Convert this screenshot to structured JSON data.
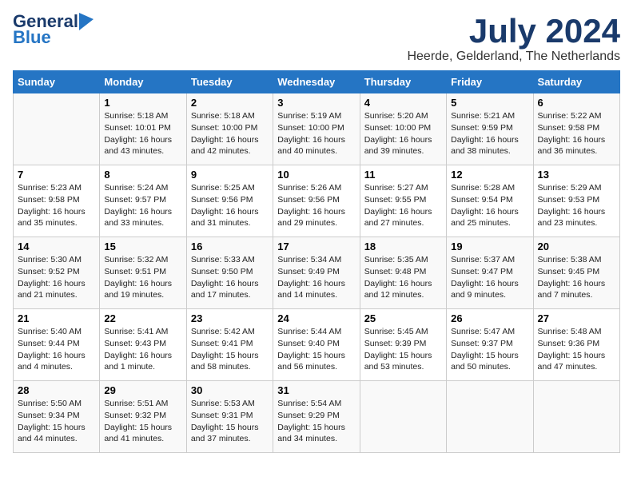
{
  "logo": {
    "general": "General",
    "blue": "Blue"
  },
  "title": "July 2024",
  "location": "Heerde, Gelderland, The Netherlands",
  "weekdays": [
    "Sunday",
    "Monday",
    "Tuesday",
    "Wednesday",
    "Thursday",
    "Friday",
    "Saturday"
  ],
  "weeks": [
    [
      {
        "day": "",
        "info": ""
      },
      {
        "day": "1",
        "info": "Sunrise: 5:18 AM\nSunset: 10:01 PM\nDaylight: 16 hours\nand 43 minutes."
      },
      {
        "day": "2",
        "info": "Sunrise: 5:18 AM\nSunset: 10:00 PM\nDaylight: 16 hours\nand 42 minutes."
      },
      {
        "day": "3",
        "info": "Sunrise: 5:19 AM\nSunset: 10:00 PM\nDaylight: 16 hours\nand 40 minutes."
      },
      {
        "day": "4",
        "info": "Sunrise: 5:20 AM\nSunset: 10:00 PM\nDaylight: 16 hours\nand 39 minutes."
      },
      {
        "day": "5",
        "info": "Sunrise: 5:21 AM\nSunset: 9:59 PM\nDaylight: 16 hours\nand 38 minutes."
      },
      {
        "day": "6",
        "info": "Sunrise: 5:22 AM\nSunset: 9:58 PM\nDaylight: 16 hours\nand 36 minutes."
      }
    ],
    [
      {
        "day": "7",
        "info": "Sunrise: 5:23 AM\nSunset: 9:58 PM\nDaylight: 16 hours\nand 35 minutes."
      },
      {
        "day": "8",
        "info": "Sunrise: 5:24 AM\nSunset: 9:57 PM\nDaylight: 16 hours\nand 33 minutes."
      },
      {
        "day": "9",
        "info": "Sunrise: 5:25 AM\nSunset: 9:56 PM\nDaylight: 16 hours\nand 31 minutes."
      },
      {
        "day": "10",
        "info": "Sunrise: 5:26 AM\nSunset: 9:56 PM\nDaylight: 16 hours\nand 29 minutes."
      },
      {
        "day": "11",
        "info": "Sunrise: 5:27 AM\nSunset: 9:55 PM\nDaylight: 16 hours\nand 27 minutes."
      },
      {
        "day": "12",
        "info": "Sunrise: 5:28 AM\nSunset: 9:54 PM\nDaylight: 16 hours\nand 25 minutes."
      },
      {
        "day": "13",
        "info": "Sunrise: 5:29 AM\nSunset: 9:53 PM\nDaylight: 16 hours\nand 23 minutes."
      }
    ],
    [
      {
        "day": "14",
        "info": "Sunrise: 5:30 AM\nSunset: 9:52 PM\nDaylight: 16 hours\nand 21 minutes."
      },
      {
        "day": "15",
        "info": "Sunrise: 5:32 AM\nSunset: 9:51 PM\nDaylight: 16 hours\nand 19 minutes."
      },
      {
        "day": "16",
        "info": "Sunrise: 5:33 AM\nSunset: 9:50 PM\nDaylight: 16 hours\nand 17 minutes."
      },
      {
        "day": "17",
        "info": "Sunrise: 5:34 AM\nSunset: 9:49 PM\nDaylight: 16 hours\nand 14 minutes."
      },
      {
        "day": "18",
        "info": "Sunrise: 5:35 AM\nSunset: 9:48 PM\nDaylight: 16 hours\nand 12 minutes."
      },
      {
        "day": "19",
        "info": "Sunrise: 5:37 AM\nSunset: 9:47 PM\nDaylight: 16 hours\nand 9 minutes."
      },
      {
        "day": "20",
        "info": "Sunrise: 5:38 AM\nSunset: 9:45 PM\nDaylight: 16 hours\nand 7 minutes."
      }
    ],
    [
      {
        "day": "21",
        "info": "Sunrise: 5:40 AM\nSunset: 9:44 PM\nDaylight: 16 hours\nand 4 minutes."
      },
      {
        "day": "22",
        "info": "Sunrise: 5:41 AM\nSunset: 9:43 PM\nDaylight: 16 hours\nand 1 minute."
      },
      {
        "day": "23",
        "info": "Sunrise: 5:42 AM\nSunset: 9:41 PM\nDaylight: 15 hours\nand 58 minutes."
      },
      {
        "day": "24",
        "info": "Sunrise: 5:44 AM\nSunset: 9:40 PM\nDaylight: 15 hours\nand 56 minutes."
      },
      {
        "day": "25",
        "info": "Sunrise: 5:45 AM\nSunset: 9:39 PM\nDaylight: 15 hours\nand 53 minutes."
      },
      {
        "day": "26",
        "info": "Sunrise: 5:47 AM\nSunset: 9:37 PM\nDaylight: 15 hours\nand 50 minutes."
      },
      {
        "day": "27",
        "info": "Sunrise: 5:48 AM\nSunset: 9:36 PM\nDaylight: 15 hours\nand 47 minutes."
      }
    ],
    [
      {
        "day": "28",
        "info": "Sunrise: 5:50 AM\nSunset: 9:34 PM\nDaylight: 15 hours\nand 44 minutes."
      },
      {
        "day": "29",
        "info": "Sunrise: 5:51 AM\nSunset: 9:32 PM\nDaylight: 15 hours\nand 41 minutes."
      },
      {
        "day": "30",
        "info": "Sunrise: 5:53 AM\nSunset: 9:31 PM\nDaylight: 15 hours\nand 37 minutes."
      },
      {
        "day": "31",
        "info": "Sunrise: 5:54 AM\nSunset: 9:29 PM\nDaylight: 15 hours\nand 34 minutes."
      },
      {
        "day": "",
        "info": ""
      },
      {
        "day": "",
        "info": ""
      },
      {
        "day": "",
        "info": ""
      }
    ]
  ]
}
